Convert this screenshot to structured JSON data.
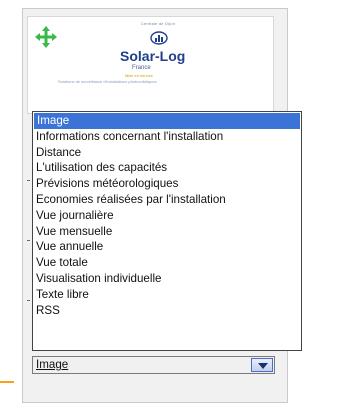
{
  "thumbnail": {
    "caption": "Centrale de Dijon",
    "brand": "Solar-Log",
    "brand_sub": "France",
    "tagline_1": "Mise en service",
    "tagline_2": "Solutions de surveillance d'installations photovoltaïques",
    "icon": "move-icon"
  },
  "dropdown": {
    "options": [
      "Image",
      "Informations concernant l'installation",
      "Distance",
      "L'utilisation des capacités",
      "Prévisions météorologiques",
      "Economies réalisées par l'installation",
      "Vue journalière",
      "Vue mensuelle",
      "Vue annuelle",
      "Vue totale",
      "Visualisation individuelle",
      "Texte libre",
      "RSS"
    ],
    "selected_index": 0,
    "selected_value": "Image",
    "arrow_icon": "chevron-down-icon"
  },
  "colors": {
    "highlight": "#3b74d6",
    "accent": "#f6a21a",
    "move_icon": "#3cb84a",
    "brand": "#1f3f8a"
  }
}
